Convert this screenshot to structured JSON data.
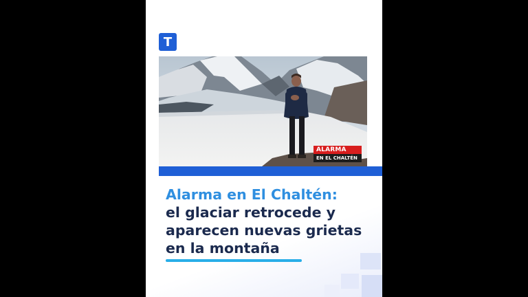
{
  "brand": {
    "logo_letter": "T",
    "accent_color": "#1f5fd6"
  },
  "video": {
    "lower_third_line1": "ALARMA",
    "lower_third_line2": "EN EL CHALTÉN"
  },
  "headline": {
    "highlight": "Alarma en El Chaltén:",
    "rest": "el glaciar retrocede y aparecen nuevas grietas en la montaña",
    "highlight_color": "#2f8fe0",
    "text_color": "#1b2a4e"
  }
}
